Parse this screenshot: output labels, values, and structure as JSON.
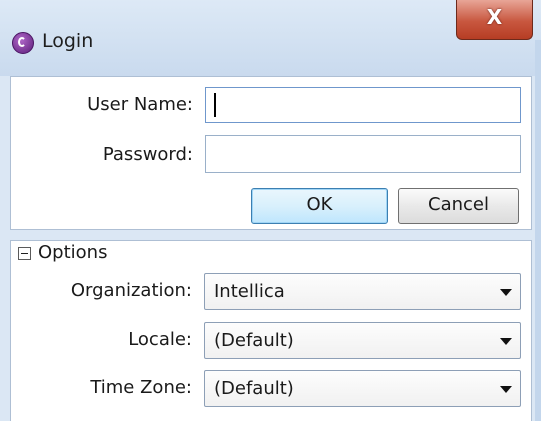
{
  "window": {
    "title": "Login",
    "close_label": "X"
  },
  "login": {
    "username_label": "User Name:",
    "username_value": "",
    "password_label": "Password:",
    "password_value": "",
    "ok_label": "OK",
    "cancel_label": "Cancel"
  },
  "options": {
    "title": "Options",
    "organization_label": "Organization:",
    "organization_value": "Intellica",
    "locale_label": "Locale:",
    "locale_value": "(Default)",
    "timezone_label": "Time Zone:",
    "timezone_value": "(Default)"
  },
  "colors": {
    "accent": "#3c7fb1",
    "close_button": "#c8573f",
    "window_frame": "#dbe7f4"
  },
  "icons": {
    "app": "app-logo-icon",
    "close": "close-icon",
    "collapse": "collapse-minus-icon",
    "dropdown": "chevron-down-icon"
  }
}
